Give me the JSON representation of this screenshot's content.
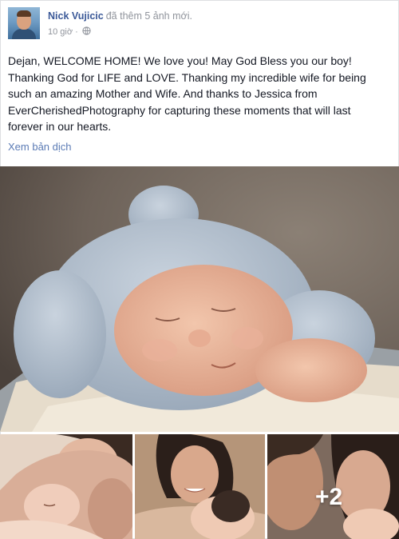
{
  "post": {
    "author": "Nick Vujicic",
    "action": "đã thêm 5 ảnh mới.",
    "time": "10 giờ",
    "separator": "·",
    "audience_icon": "globe-icon",
    "text_lines": [
      "Dejan, WELCOME HOME! We love you! May God Bless you our boy!",
      "Thanking God for LIFE and LOVE. Thanking my incredible wife for being",
      "such an amazing Mother and Wife. And thanks to Jessica from",
      "EverCherishedPhotography for capturing these moments that will last",
      "forever in our hearts."
    ],
    "translate_label": "Xem bản dịch",
    "more_photos": "+2"
  },
  "colors": {
    "author": "#3b5998",
    "meta": "#90949c",
    "text": "#141823",
    "link": "#5b7bb5"
  }
}
